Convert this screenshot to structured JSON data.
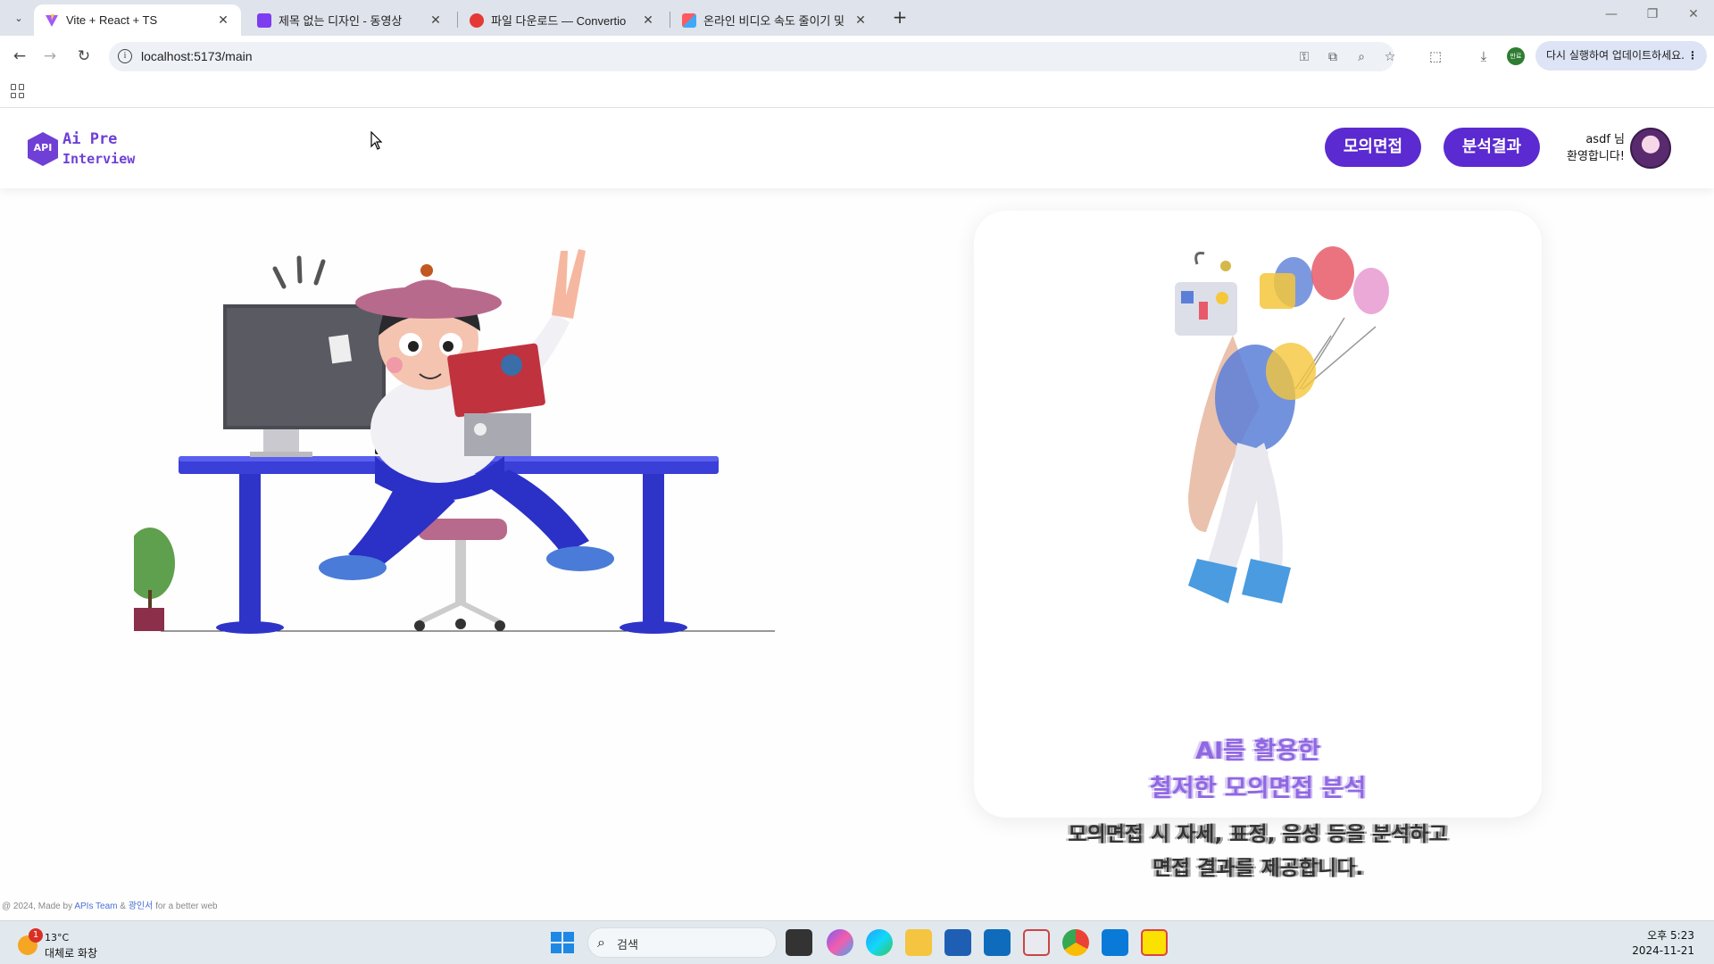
{
  "browser": {
    "tabs": [
      {
        "title": "Vite + React + TS",
        "favicon": "vite-icon",
        "active": true
      },
      {
        "title": "제목 없는 디자인 - 동영상",
        "favicon": "video-icon",
        "active": false
      },
      {
        "title": "파일 다운로드 — Convertio",
        "favicon": "convertio-icon",
        "active": false
      },
      {
        "title": "온라인 비디오 속도 줄이기 및",
        "favicon": "clideo-icon",
        "active": false
      }
    ],
    "url": "localhost:5173/main",
    "profile_label": "만료",
    "update_label": "다시 실행하여 업데이트하세요."
  },
  "site": {
    "logo_badge": "API",
    "logo_line1": "Ai Pre",
    "logo_line2": "Interview",
    "nav": {
      "mock_interview": "모의면접",
      "analysis_result": "분석결과"
    },
    "user": {
      "name_line": "asdf 님",
      "welcome_line": "환영합니다!"
    },
    "card": {
      "title_line1": "AI를 활용한",
      "title_line2": "철저한 모의면접 분석",
      "desc_line1": "모의면접 시 자세, 표정, 음성 등을 분석하고",
      "desc_line2": "면접 결과를 제공합니다."
    },
    "footer": {
      "prefix": "@ 2024, Made by ",
      "team": "APIs Team",
      "amp": " & ",
      "uni": "광인서",
      "suffix": " for a better web"
    }
  },
  "taskbar": {
    "weather_temp": "13°C",
    "weather_cond": "대체로 화창",
    "weather_badge": "1",
    "search_label": "검색",
    "time": "오후 5:23",
    "date": "2024-11-21"
  }
}
